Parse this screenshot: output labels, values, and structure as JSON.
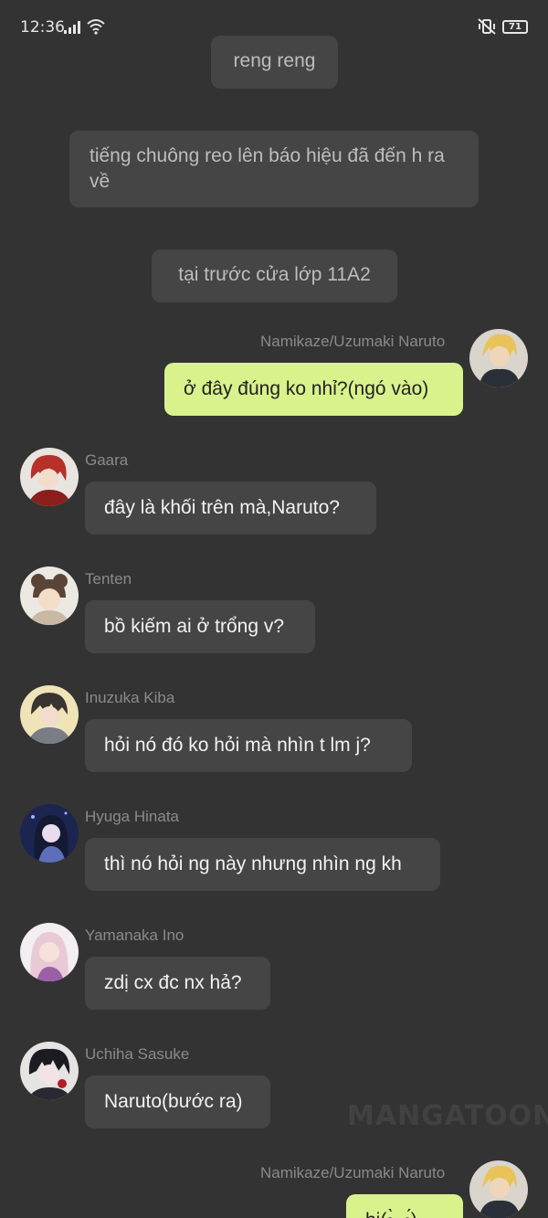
{
  "status_bar": {
    "time": "12:36",
    "battery": "71"
  },
  "narrations": [
    {
      "text": "reng reng"
    },
    {
      "text": "tiếng chuông reo lên báo hiệu đã đến h ra về"
    },
    {
      "text": "tại trước cửa lớp 11A2"
    }
  ],
  "messages": [
    {
      "sender": "Namikaze/Uzumaki Naruto",
      "text": "ở đây đúng ko nhỉ?(ngó vào)",
      "self": true
    },
    {
      "sender": "Gaara",
      "text": "đây là khối trên mà,Naruto?"
    },
    {
      "sender": "Tenten",
      "text": "bồ kiếm ai ở trổng v?"
    },
    {
      "sender": "Inuzuka Kiba",
      "text": "hỏi nó đó ko hỏi mà nhìn t lm j?"
    },
    {
      "sender": "Hyuga Hinata",
      "text": "thì nó hỏi ng này nhưng nhìn ng kh"
    },
    {
      "sender": "Yamanaka Ino",
      "text": "zdị cx đc nx hả?"
    },
    {
      "sender": "Uchiha Sasuke",
      "text": "Naruto(bước ra)"
    },
    {
      "sender": "Namikaze/Uzumaki Naruto",
      "text": "hi(•̀ᴗ•́)",
      "self": true
    }
  ],
  "watermark": "MANGATOON"
}
